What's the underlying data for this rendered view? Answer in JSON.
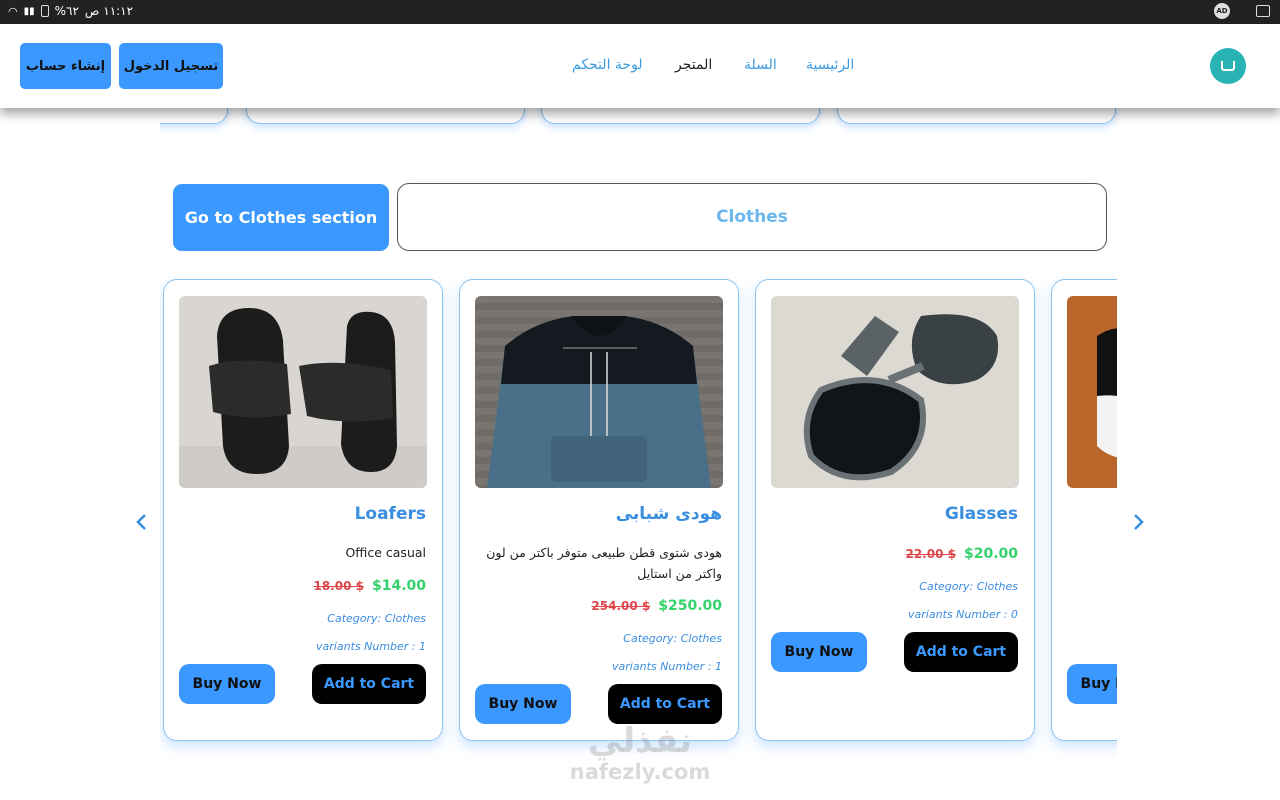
{
  "status_bar": {
    "time": "١١:١٢ ص",
    "battery": "٦٢%"
  },
  "nav": {
    "signup_label": "إنشاء حساب",
    "login_label": "تسجيل الدخول",
    "links": [
      "الرئيسية",
      "السلة",
      "المتجر",
      "لوحة التحكم"
    ],
    "active_link": "المتجر"
  },
  "section": {
    "go_button_label": "Go to Clothes section",
    "title": "Clothes"
  },
  "products": [
    {
      "title": "Loafers",
      "description": "Office casual",
      "old_price": "18.00 $",
      "price": "$14.00",
      "category": "Category: Clothes",
      "variants": "variants Number : 1",
      "buy_label": "Buy Now",
      "add_label": "Add to Cart",
      "image": "black-slides"
    },
    {
      "title": "هودى شبابى",
      "description": "هودى شتوى قطن طبيعى متوفر باكتر من لون واكتر من استايل",
      "old_price": "254.00 $",
      "price": "$250.00",
      "category": "Category: Clothes",
      "variants": "variants Number : 1",
      "buy_label": "Buy Now",
      "add_label": "Add to Cart",
      "image": "blue-hoodie"
    },
    {
      "title": "Glasses",
      "description": "",
      "old_price": "22.00 $",
      "price": "$20.00",
      "category": "Category: Clothes",
      "variants": "variants Number : 0",
      "buy_label": "Buy Now",
      "add_label": "Add to Cart",
      "image": "sunglasses"
    },
    {
      "title": "",
      "description": "",
      "old_price": "",
      "price": "",
      "category": "",
      "variants": "",
      "buy_label": "Buy Now",
      "add_label": "",
      "image": "cap"
    }
  ],
  "watermark": {
    "arabic": "نفذلي",
    "latin": "nafezly.com"
  },
  "icons": {
    "prev": "chevron-left-icon",
    "next": "chevron-right-icon"
  },
  "colors": {
    "accent": "#3a98ff",
    "link": "#3a9be0",
    "old_price": "#e0474c",
    "new_price": "#33d26a"
  }
}
